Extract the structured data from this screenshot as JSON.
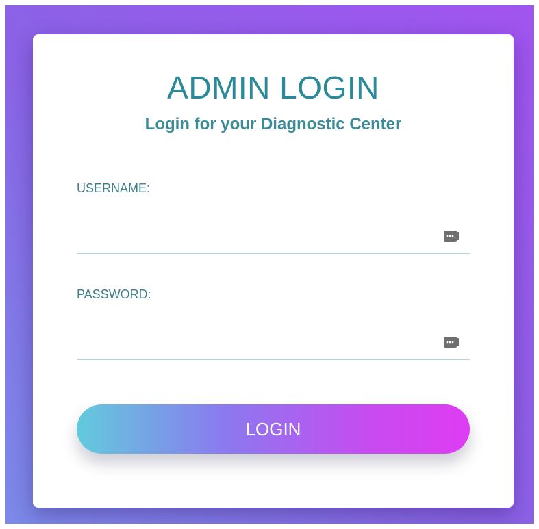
{
  "form": {
    "title": "ADMIN LOGIN",
    "subtitle": "Login for your Diagnostic Center",
    "username": {
      "label": "USERNAME:",
      "value": ""
    },
    "password": {
      "label": "PASSWORD:",
      "value": ""
    },
    "login_button": "LOGIN"
  },
  "icons": {
    "field_icon": "password-manager-icon"
  },
  "colors": {
    "title": "#2b8a99",
    "background_gradient": [
      "#7b8ae8",
      "#a154ef"
    ],
    "button_gradient": [
      "#62cbdc",
      "#de3cf3"
    ]
  }
}
